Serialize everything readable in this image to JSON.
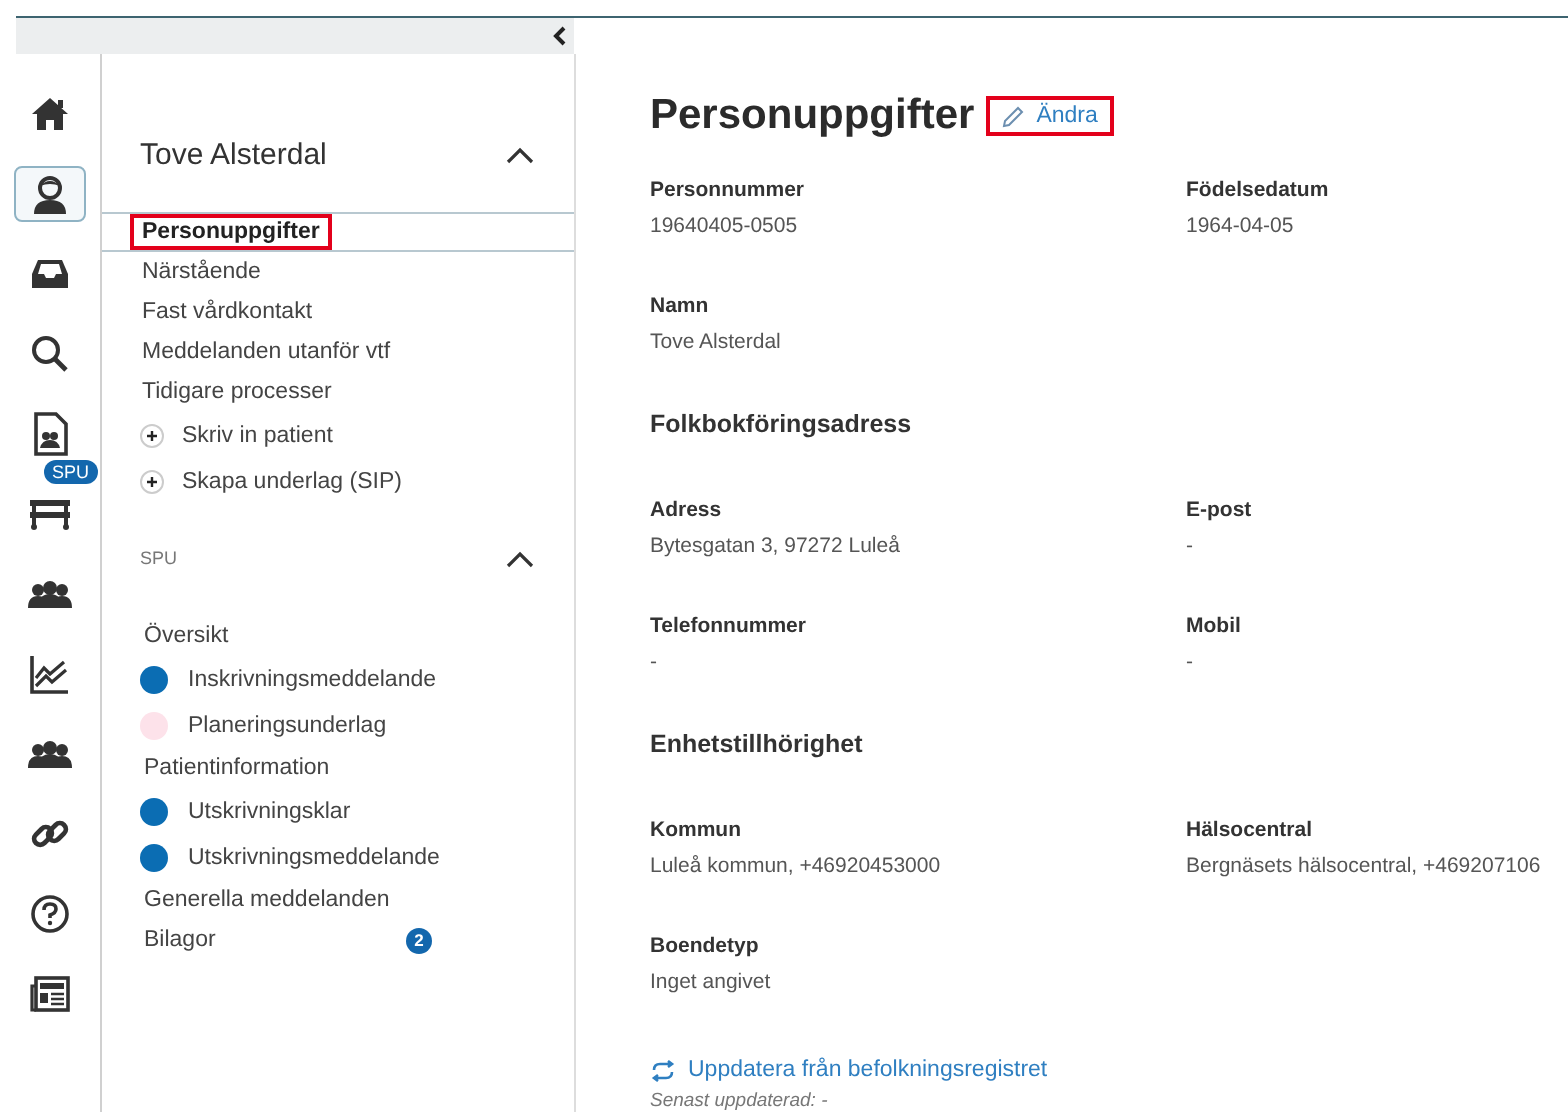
{
  "rail": {
    "items": [
      {
        "selected": false
      },
      {
        "selected": true
      },
      {
        "selected": false
      },
      {
        "selected": false
      },
      {
        "selected": false,
        "badge": "SPU"
      },
      {
        "selected": false
      },
      {
        "selected": false
      },
      {
        "selected": false
      },
      {
        "selected": false
      },
      {
        "selected": false
      },
      {
        "selected": false
      },
      {
        "selected": false
      }
    ]
  },
  "sidebar": {
    "patient": {
      "title": "Tove Alsterdal",
      "expanded": true,
      "items": [
        {
          "label": "Personuppgifter",
          "selected": true,
          "highlighted": true
        },
        {
          "label": "Närstående",
          "selected": false,
          "highlighted": false
        },
        {
          "label": "Fast vårdkontakt",
          "selected": false,
          "highlighted": false
        },
        {
          "label": "Meddelanden utanför vtf",
          "selected": false,
          "highlighted": false
        },
        {
          "label": "Tidigare processer",
          "selected": false,
          "highlighted": false
        }
      ],
      "actions": [
        {
          "label": "Skriv in patient"
        },
        {
          "label": "Skapa underlag (SIP)"
        }
      ]
    },
    "spu": {
      "title": "SPU",
      "expanded": true,
      "items": [
        {
          "kind": "plain",
          "label": "Översikt"
        },
        {
          "kind": "status",
          "label": "Inskrivningsmeddelande",
          "color": "#0b6db3"
        },
        {
          "kind": "status",
          "label": "Planeringsunderlag",
          "color": "#fde2ea"
        },
        {
          "kind": "plain",
          "label": "Patientinformation"
        },
        {
          "kind": "status",
          "label": "Utskrivningsklar",
          "color": "#0b6db3"
        },
        {
          "kind": "status",
          "label": "Utskrivningsmeddelande",
          "color": "#0b6db3"
        },
        {
          "kind": "plain",
          "label": "Generella meddelanden"
        },
        {
          "kind": "plain",
          "label": "Bilagor",
          "badge": "2"
        }
      ]
    }
  },
  "main": {
    "title": "Personuppgifter",
    "edit_button": {
      "label": "Ändra",
      "highlighted": true
    },
    "blocks": [
      {
        "kind": "fields",
        "fields": [
          {
            "label": "Personnummer",
            "value": "19640405-0505"
          },
          {
            "label": "Födelsedatum",
            "value": "1964-04-05"
          }
        ]
      },
      {
        "kind": "fields",
        "fields": [
          {
            "label": "Namn",
            "value": "Tove Alsterdal"
          }
        ]
      },
      {
        "kind": "heading",
        "text": "Folkbokföringsadress"
      },
      {
        "kind": "fields",
        "fields": [
          {
            "label": "Adress",
            "value": "Bytesgatan 3, 97272 Luleå"
          },
          {
            "label": "E-post",
            "value": "-"
          }
        ]
      },
      {
        "kind": "fields",
        "fields": [
          {
            "label": "Telefonnummer",
            "value": "-"
          },
          {
            "label": "Mobil",
            "value": "-"
          }
        ]
      },
      {
        "kind": "heading",
        "text": "Enhetstillhörighet"
      },
      {
        "kind": "fields",
        "fields": [
          {
            "label": "Kommun",
            "value": "Luleå kommun, +46920453000"
          },
          {
            "label": "Hälsocentral",
            "value": "Bergnäsets hälsocentral, +469207106"
          }
        ]
      },
      {
        "kind": "fields",
        "fields": [
          {
            "label": "Boendetyp",
            "value": "Inget angivet"
          }
        ]
      }
    ],
    "refresh_link": "Uppdatera från befolkningsregistret",
    "last_updated": "Senast uppdaterad: -"
  }
}
